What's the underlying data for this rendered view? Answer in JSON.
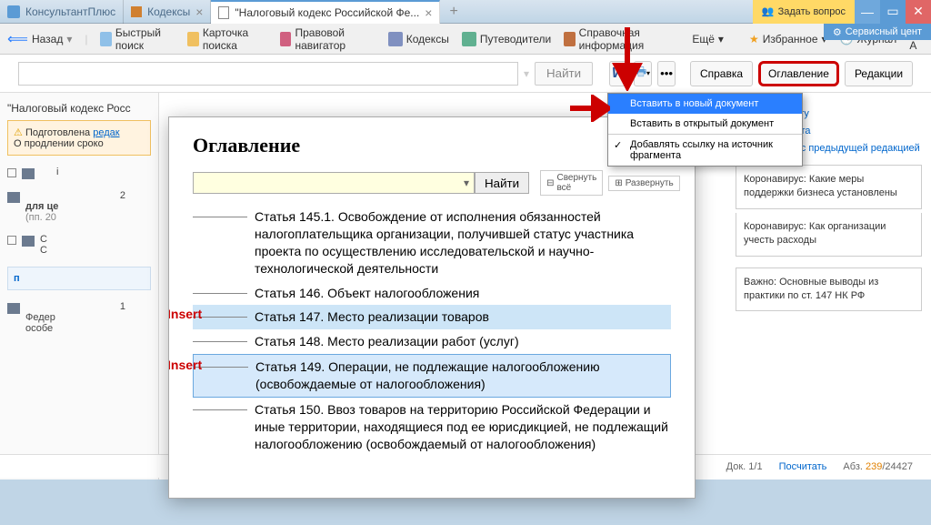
{
  "tabs": [
    {
      "label": "КонсультантПлюс"
    },
    {
      "label": "Кодексы"
    },
    {
      "label": "\"Налоговый кодекс Российской Фе..."
    }
  ],
  "topright": {
    "ask": "Задать вопрос",
    "service": "Сервисный цент"
  },
  "toolbar": {
    "back": "Назад",
    "qsearch": "Быстрый поиск",
    "card": "Карточка поиска",
    "nav": "Правовой навигатор",
    "codex": "Кодексы",
    "guide": "Путеводители",
    "ref": "Справочная информация",
    "more": "Ещё",
    "fav": "Избранное",
    "journal": "Журнал",
    "font": "A-A"
  },
  "mainbar": {
    "find": "Найти",
    "help": "Справка",
    "toc": "Оглавление",
    "editions": "Редакции"
  },
  "left": {
    "title": "\"Налоговый кодекс Росс",
    "warn_a": "Подготовлена ",
    "warn_link": "редак",
    "warn_b": "О продлении сроко",
    "row1": "2",
    "row1b": "для це",
    "row1c": "(пп. 20",
    "row2": "С",
    "row2b": "С",
    "row3": "п",
    "row4": "1",
    "row4b": "Федер",
    "row4c": "особе"
  },
  "toc": {
    "title": "Оглавление",
    "find": "Найти",
    "collapse": "Свернуть всё",
    "expand": "Развернуть",
    "items": [
      "Статья 145.1. Освобождение от исполнения обязанностей налогоплательщика организации, получившей статус участника проекта по осуществлению исследовательской и научно-технологической деятельности",
      "Статья 146. Объект налогообложения",
      "Статья 147. Место реализации товаров",
      "Статья 148. Место реализации работ (услуг)",
      "Статья 149. Операции, не подлежащие налогообложению (освобождаемые от налогообложения)",
      "Статья 150. Ввоз товаров на территорию Российской Федерации и иные территории, находящиеся под ее юрисдикцией, не подлежащий налогообложению (освобождаемый от налогообложения)"
    ],
    "insert": "Insert"
  },
  "dropdown": {
    "items": [
      "Вставить в новый документ",
      "Вставить в открытый документ",
      "Добавлять ссылку на источник фрагмента"
    ]
  },
  "right": {
    "link1": "к документу",
    "link2": "й документа",
    "compare": "Сравнить с предыдущей редакцией",
    "box1": "Коронавирус: Какие меры поддержки бизнеса установлены",
    "box2": "Коронавирус: Как организации учесть расходы",
    "box3": "Важно: Основные выводы из практики по ст. 147 НК РФ"
  },
  "status": {
    "doc": "Док. 1/1",
    "calc": "Посчитать",
    "abz_label": "Абз. ",
    "abz_cur": "239",
    "abz_total": "/24427"
  }
}
